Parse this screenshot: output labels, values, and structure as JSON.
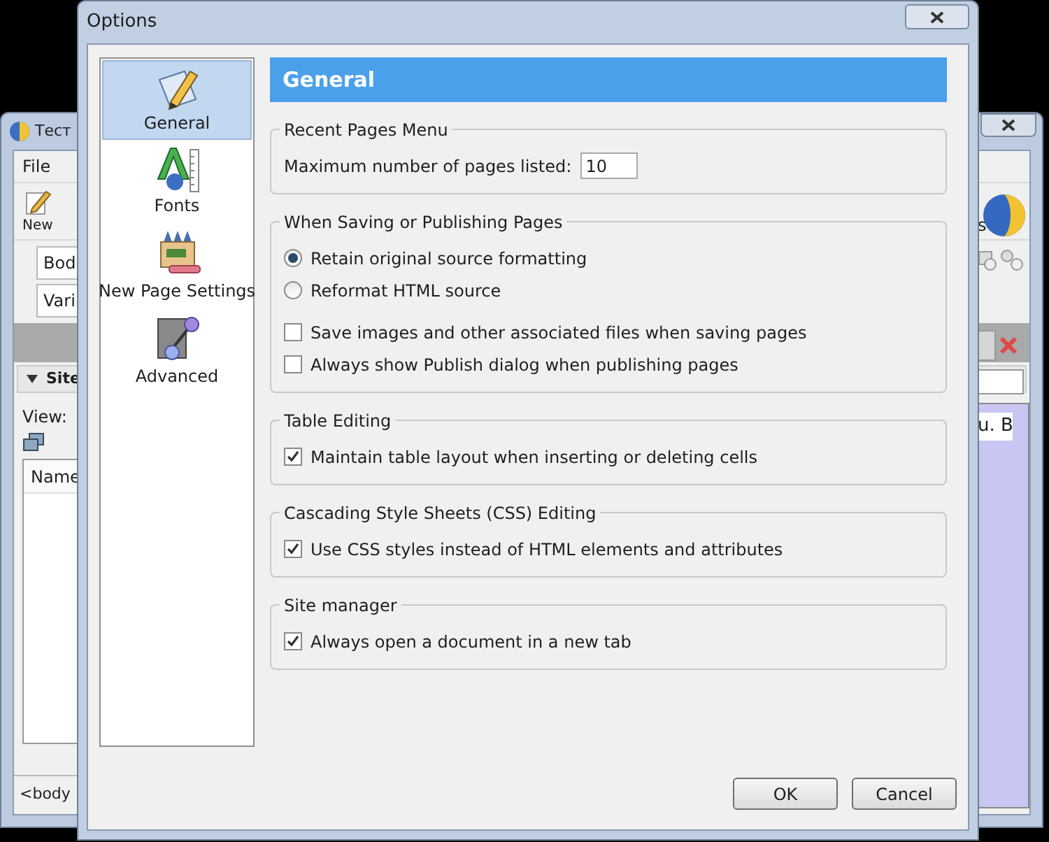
{
  "background_window": {
    "title": "Тест",
    "menu": [
      "File"
    ],
    "toolbar_button": "New",
    "fields": [
      "Bod",
      "Vari"
    ],
    "panel_title": "Site",
    "view_label": "View:",
    "column": "Name",
    "status_bar": "<body",
    "right_texts": [
      "s",
      "u. B"
    ]
  },
  "dialog": {
    "title": "Options",
    "categories": [
      {
        "label": "General",
        "selected": true
      },
      {
        "label": "Fonts",
        "selected": false
      },
      {
        "label": "New Page Settings",
        "selected": false
      },
      {
        "label": "Advanced",
        "selected": false
      }
    ],
    "panel_title": "General",
    "groups": [
      {
        "title": "Recent Pages Menu",
        "items": [
          {
            "kind": "number",
            "label": "Maximum number of pages listed:",
            "value": "10"
          }
        ]
      },
      {
        "title": "When Saving or Publishing Pages",
        "items": [
          {
            "kind": "radio",
            "label": "Retain original source formatting",
            "selected": true
          },
          {
            "kind": "radio",
            "label": "Reformat HTML source",
            "selected": false
          },
          {
            "kind": "checkbox",
            "label": "Save images and other associated files when saving pages",
            "checked": false
          },
          {
            "kind": "checkbox",
            "label": "Always show Publish dialog when publishing pages",
            "checked": false
          }
        ]
      },
      {
        "title": "Table Editing",
        "items": [
          {
            "kind": "checkbox",
            "label": "Maintain table layout when inserting or deleting cells",
            "checked": true
          }
        ]
      },
      {
        "title": "Cascading Style Sheets (CSS) Editing",
        "items": [
          {
            "kind": "checkbox",
            "label": "Use CSS styles instead of HTML elements and attributes",
            "checked": true
          }
        ]
      },
      {
        "title": "Site manager",
        "items": [
          {
            "kind": "checkbox",
            "label": "Always open a document in a new tab",
            "checked": true
          }
        ]
      }
    ],
    "buttons": [
      "OK",
      "Cancel"
    ]
  }
}
